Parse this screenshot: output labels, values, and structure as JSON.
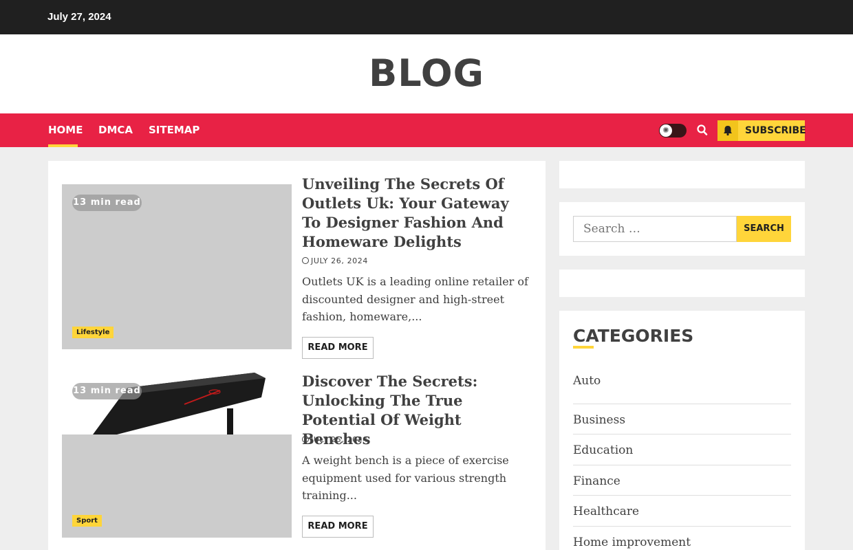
{
  "topbar": {
    "date": "July 27, 2024"
  },
  "site": {
    "title": "BLOG"
  },
  "nav": {
    "items": [
      "HOME",
      "DMCA",
      "SITEMAP"
    ],
    "toggle_icon": "sun-icon",
    "search_icon": "search-icon",
    "subscribe_label": "SUBSCRIBE",
    "subscribe_icon": "bell-icon",
    "accent_color": "#e82245",
    "highlight_color": "#ffd53a"
  },
  "posts": [
    {
      "read_time": "13 min read",
      "category": "Lifestyle",
      "title": "Unveiling The Secrets Of Outlets Uk: Your Gateway To Designer Fashion And Homeware Delights",
      "date": "JULY 26, 2024",
      "excerpt": "Outlets UK is a leading online retailer of discounted designer and high-street fashion, homeware,...",
      "read_more": "READ MORE"
    },
    {
      "read_time": "13 min read",
      "category": "Sport",
      "title": "Discover The Secrets: Unlocking The True Potential Of Weight Benches",
      "date": "JULY 25, 2024",
      "excerpt": "A weight bench is a piece of exercise equipment used for various strength training...",
      "read_more": "READ MORE"
    }
  ],
  "sidebar": {
    "search": {
      "placeholder": "Search …",
      "button": "SEARCH"
    },
    "categories": {
      "heading": "CATEGORIES",
      "items": [
        "Auto",
        "Business",
        "Education",
        "Finance",
        "Healthcare",
        "Home improvement"
      ]
    }
  }
}
